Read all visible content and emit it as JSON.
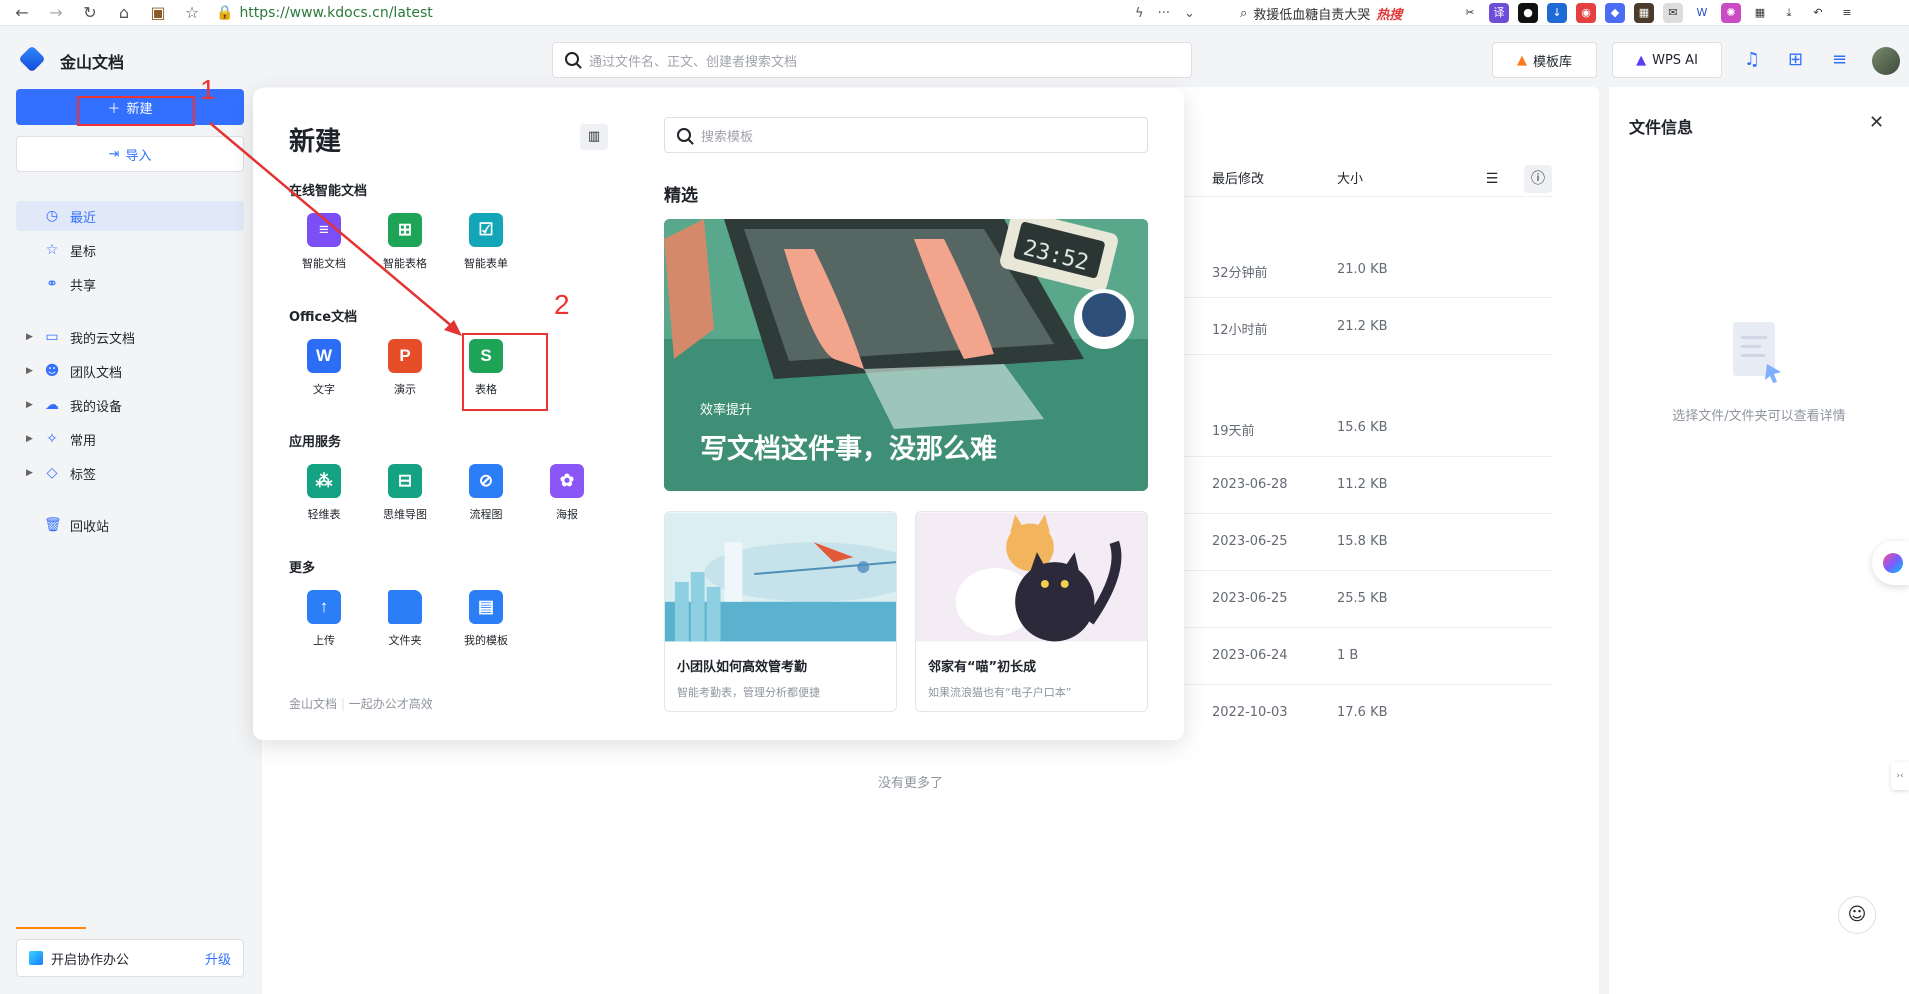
{
  "browser": {
    "url": "https://www.kdocs.cn/latest",
    "news_search": "救援低血糖自责大哭",
    "news_badge": "热搜"
  },
  "app": {
    "name": "金山文档",
    "search_placeholder": "通过文件名、正文、创建者搜索文档",
    "template_lib": "模板库",
    "wps_ai": "WPS AI"
  },
  "sidebar": {
    "new_label": "新建",
    "import_label": "导入",
    "items": [
      {
        "label": "最近",
        "icon": "clock-icon"
      },
      {
        "label": "星标",
        "icon": "star-icon"
      },
      {
        "label": "共享",
        "icon": "share-icon"
      }
    ],
    "groups": [
      {
        "label": "我的云文档",
        "icon": "folder-icon"
      },
      {
        "label": "团队文档",
        "icon": "team-icon"
      },
      {
        "label": "我的设备",
        "icon": "cloud-icon"
      },
      {
        "label": "常用",
        "icon": "pin-icon"
      },
      {
        "label": "标签",
        "icon": "tag-icon"
      }
    ],
    "trash_label": "回收站",
    "collab_label": "开启协作办公",
    "upgrade_label": "升级"
  },
  "main": {
    "col_modified": "最后修改",
    "col_size": "大小",
    "rows": [
      {
        "modified": "32分钟前",
        "size": "21.0 KB"
      },
      {
        "modified": "12小时前",
        "size": "21.2 KB"
      },
      {
        "modified": "19天前",
        "size": "15.6 KB"
      },
      {
        "modified": "2023-06-28",
        "size": "11.2 KB"
      },
      {
        "modified": "2023-06-25",
        "size": "15.8 KB"
      },
      {
        "modified": "2023-06-25",
        "size": "25.5 KB"
      },
      {
        "modified": "2023-06-24",
        "size": "1 B"
      },
      {
        "modified": "2022-10-03",
        "size": "17.6 KB"
      }
    ],
    "no_more": "没有更多了"
  },
  "detail": {
    "title": "文件信息",
    "empty_hint": "选择文件/文件夹可以查看详情"
  },
  "popup": {
    "title": "新建",
    "sections": [
      {
        "title": "在线智能文档",
        "tiles": [
          {
            "label": "智能文档",
            "glyph": "≡",
            "color": "#7b4ff5"
          },
          {
            "label": "智能表格",
            "glyph": "⊞",
            "color": "#1ea456"
          },
          {
            "label": "智能表单",
            "glyph": "☑",
            "color": "#12a6b8"
          }
        ]
      },
      {
        "title": "Office文档",
        "tiles": [
          {
            "label": "文字",
            "glyph": "W",
            "color": "#2b6ef5"
          },
          {
            "label": "演示",
            "glyph": "P",
            "color": "#e64e2a"
          },
          {
            "label": "表格",
            "glyph": "S",
            "color": "#1ea456"
          }
        ]
      },
      {
        "title": "应用服务",
        "tiles": [
          {
            "label": "轻维表",
            "glyph": "⁂",
            "color": "#13a382"
          },
          {
            "label": "思维导图",
            "glyph": "⊟",
            "color": "#13a382"
          },
          {
            "label": "流程图",
            "glyph": "⊘",
            "color": "#2b7ef5"
          },
          {
            "label": "海报",
            "glyph": "✿",
            "color": "#8a56f5"
          }
        ]
      },
      {
        "title": "更多",
        "tiles": [
          {
            "label": "上传",
            "glyph": "↑",
            "color": "#2b7ef5"
          },
          {
            "label": "文件夹",
            "glyph": "",
            "color": "#2b7ef5"
          },
          {
            "label": "我的模板",
            "glyph": "▤",
            "color": "#2b7ef5"
          }
        ]
      }
    ],
    "footer_brand": "金山文档",
    "footer_slogan": "一起办公才高效",
    "template_search": "搜索模板",
    "featured": "精选",
    "hero_tag": "效率提升",
    "hero_headline": "写文档这件事，没那么难",
    "hero_clock": "23:52",
    "cards": [
      {
        "title": "小团队如何高效管考勤",
        "subtitle": "智能考勤表，管理分析都便捷"
      },
      {
        "title": "邻家有“喵”初长成",
        "subtitle": "如果流浪猫也有“电子户口本”"
      }
    ]
  },
  "annotations": {
    "step1": "1",
    "step2": "2",
    "color": "#e33333"
  }
}
